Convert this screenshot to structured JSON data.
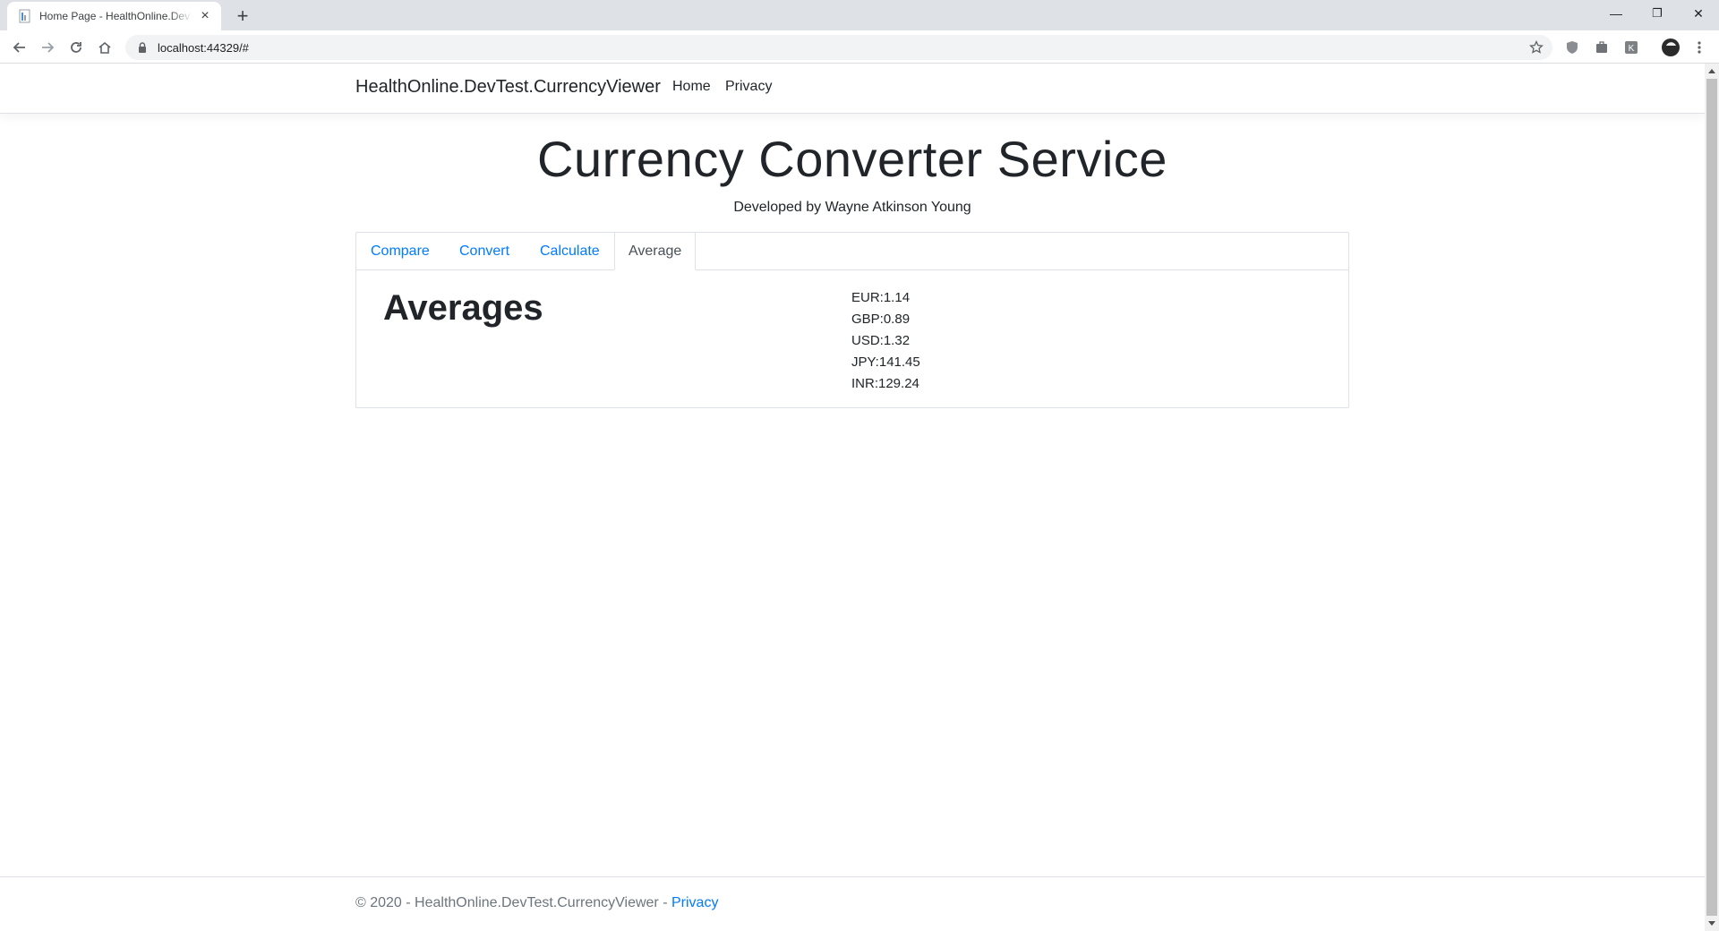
{
  "browser": {
    "tab_title": "Home Page - HealthOnline.DevTest.CurrencyViewer",
    "new_tab_symbol": "+",
    "url": "localhost:44329/#",
    "win_minimize": "—",
    "win_restore": "❐",
    "win_close": "✕"
  },
  "navbar": {
    "brand": "HealthOnline.DevTest.CurrencyViewer",
    "links": [
      "Home",
      "Privacy"
    ]
  },
  "header": {
    "title": "Currency Converter Service",
    "subtitle": "Developed by Wayne Atkinson Young"
  },
  "tabs": [
    {
      "label": "Compare",
      "active": false
    },
    {
      "label": "Convert",
      "active": false
    },
    {
      "label": "Calculate",
      "active": false
    },
    {
      "label": "Average",
      "active": true
    }
  ],
  "averages": {
    "heading": "Averages",
    "items": [
      "EUR:1.14",
      "GBP:0.89",
      "USD:1.32",
      "JPY:141.45",
      "INR:129.24"
    ]
  },
  "footer": {
    "text": "© 2020 - HealthOnline.DevTest.CurrencyViewer - ",
    "link": "Privacy"
  },
  "colors": {
    "link": "#007bff",
    "text": "#212529",
    "muted": "#6c757d",
    "border": "#dee2e6"
  }
}
